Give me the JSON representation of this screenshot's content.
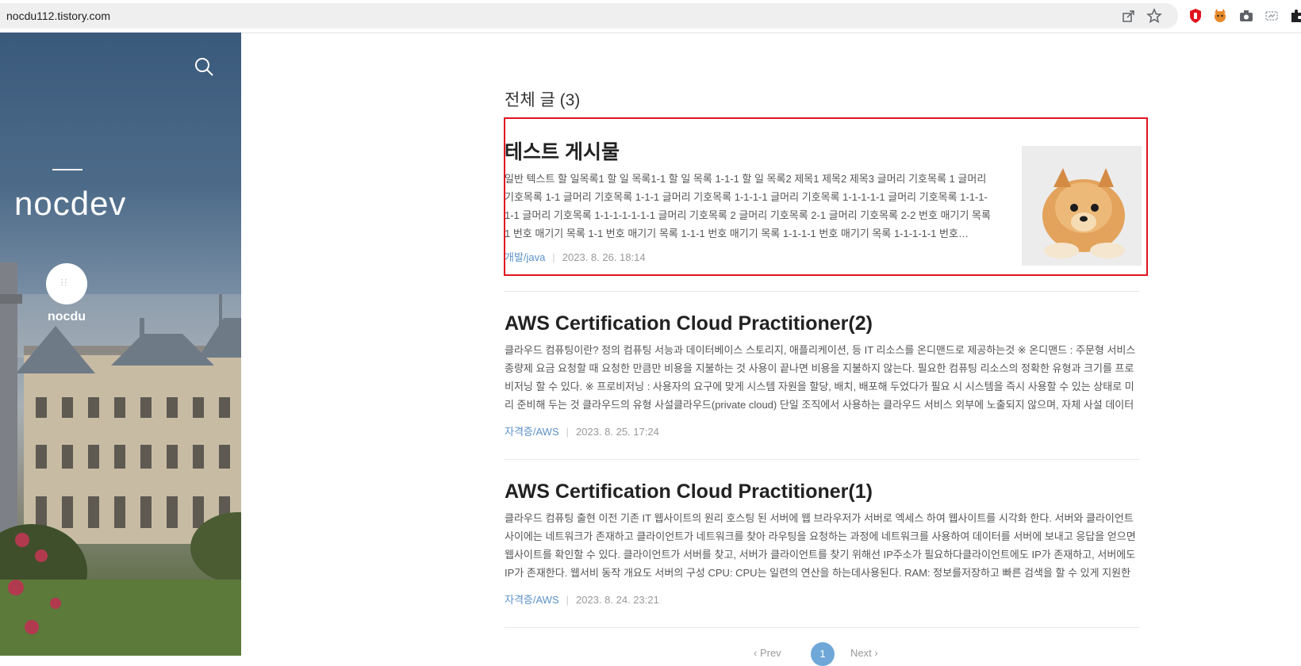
{
  "browser": {
    "url": "nocdu112.tistory.com",
    "toolbar_icons": [
      "share-icon",
      "star-icon"
    ],
    "extensions": [
      "red-shield-extension-icon",
      "cat-extension-icon",
      "camera-extension-icon",
      "screenshot-extension-icon",
      "puzzle-extension-icon"
    ]
  },
  "sidebar": {
    "blog_title": "nocdev",
    "user_name": "nocdu",
    "search_icon": "search-icon"
  },
  "main": {
    "heading": "전체 글 (3)",
    "posts": [
      {
        "title": "테스트 게시물",
        "excerpt": "일반 텍스트 할 일목록1 할 일 목록1-1 할 일 목록 1-1-1 할 일 목록2 제목1 제목2 제목3 글머리 기호목록 1 글머리 기호목록 1-1 글머리 기호목록 1-1-1 글머리 기호목록 1-1-1-1 글머리 기호목록 1-1-1-1-1 글머리 기호목록 1-1-1-1-1 글머리 기호목록 1-1-1-1-1-1-1 글머리 기호목록 2 글머리 기호목록 2-1 글머리 기호목록 2-2 번호 매기기 목록1 번호 매기기 목록 1-1 번호 매기기 목록 1-1-1 번호 매기기 목록 1-1-1-1 번호 매기기 목록 1-1-1-1-1 번호…",
        "category": "개발/java",
        "date": "2023. 8. 26. 18:14",
        "has_thumbnail": true
      },
      {
        "title": "AWS Certification Cloud Practitioner(2)",
        "excerpt": "클라우드 컴퓨팅이란? 정의 컴퓨팅 서능과 데이터베이스 스토리지, 애플리케이션, 등 IT 리소스를 온디맨드로 제공하는것 ※ 온디맨드 : 주문형 서비스 종량제 요금 요청할 때 요청한 만큼만 비용을 지불하는 것 사용이 끝나면 비용을 지불하지 않는다. 필요한 컴퓨팅 리소스의 정확한 유형과 크기를 프로비저닝 할 수 있다. ※ 프로비저닝 : 사용자의 요구에 맞게 시스템 자원을 할당, 배치, 배포해 두었다가 필요 시 시스템을 즉시 사용할 수 있는 상태로 미리 준비해 두는 것 클라우드의 유형 사설클라우드(private cloud) 단일 조직에서 사용하는 클라우드 서비스 외부에 노출되지 않으며, 자체 사설 데이터센터를 …",
        "category": "자격증/AWS",
        "date": "2023. 8. 25. 17:24"
      },
      {
        "title": "AWS Certification Cloud Practitioner(1)",
        "excerpt": "클라우드 컴퓨팅 출현 이전 기존 IT 웹사이트의 원리 호스팅 된 서버에 웹 브라우저가 서버로 엑세스 하여 웹사이트를 시각화 한다. 서버와 클라이언트 사이에는 네트워크가 존재하고 클라이언트가 네트워크를 찾아 라우팅을 요청하는 과정에 네트워크를 사용하여 데이터를 서버에 보내고 응답을 얻으면 웹사이트를 확인할 수 있다. 클라이언트가 서버를 찾고, 서버가 클라이언트를 찾기 위해선 IP주소가 필요하다클라이언트에도 IP가 존재하고, 서버에도 IP가 존재한다. 웹서비 동작 개요도 서버의 구성 CPU: CPU는 일련의 연산을 하는데사용된다. RAM: 정보를저장하고 빠른 검색을 할 수 있게 지원한다. stor…",
        "category": "자격증/AWS",
        "date": "2023. 8. 24. 23:21"
      }
    ]
  },
  "pagination": {
    "prev": "‹ Prev",
    "current": "1",
    "next": "Next ›"
  },
  "colors": {
    "highlight_border": "#e1141e",
    "category_link": "#5b91c7",
    "page_active": "#6fa8d8"
  }
}
